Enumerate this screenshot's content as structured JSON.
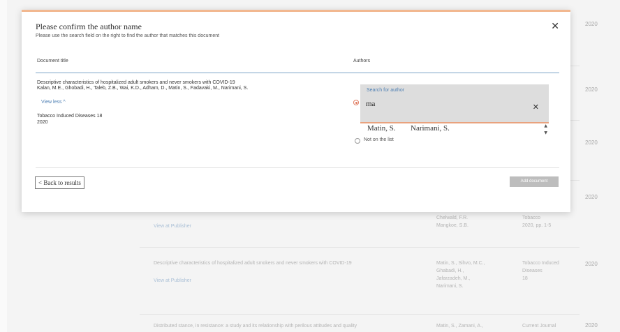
{
  "background": {
    "year": "2020",
    "row_a": {
      "title": "",
      "link": "View at Publisher",
      "authors": [
        "Chelwald, F.R.",
        "Mangkoe, S.B."
      ],
      "source": [
        "Tobacco",
        "2020, pp. 1-5"
      ]
    },
    "row_b": {
      "title": "Descriptive characteristics of hospitalized adult smokers and never smokers with COVID-19",
      "link": "View at Publisher",
      "authors": [
        "Matin, S., Sihvo, M.C.,",
        "Ghabadi, H.,",
        "Jafarzadeh, M.,",
        "Narimani, S."
      ],
      "source": [
        "Tobacco Induced",
        "Diseases",
        "18"
      ]
    },
    "row_c": {
      "title": "Distributed stance, in resistance: a study and its relationship with perilous attitudes and quality",
      "authors": "Matin, S., Zamani, A.,",
      "source": "Current Journal"
    }
  },
  "modal": {
    "title": "Please confirm the author name",
    "subtitle": "Please use the search field on the right to find the author that matches this document",
    "close_icon": "close-icon",
    "columns": {
      "document_title": "Document title",
      "authors": "Authors"
    },
    "document": {
      "title": "Descriptive characteristics of hospitalized adult smokers and never smokers with COVID-19",
      "authors": "Kalan, M.E., Ghobadi, H., Taleb, Z.B., Wai, K.D., Adham, D., Matin, S., Fadavaki, M., Narimani, S.",
      "view_less": "View less ^",
      "source": "Tobacco Induced Diseases 18",
      "year": "2020"
    },
    "search": {
      "label": "Search for author",
      "value": "ma",
      "clear_icon": "close-icon"
    },
    "results": [
      "Matin, S.",
      "Narimani, S."
    ],
    "not_on_list": "Not on the list",
    "back_button": "< Back to results",
    "add_button": "Add document"
  }
}
